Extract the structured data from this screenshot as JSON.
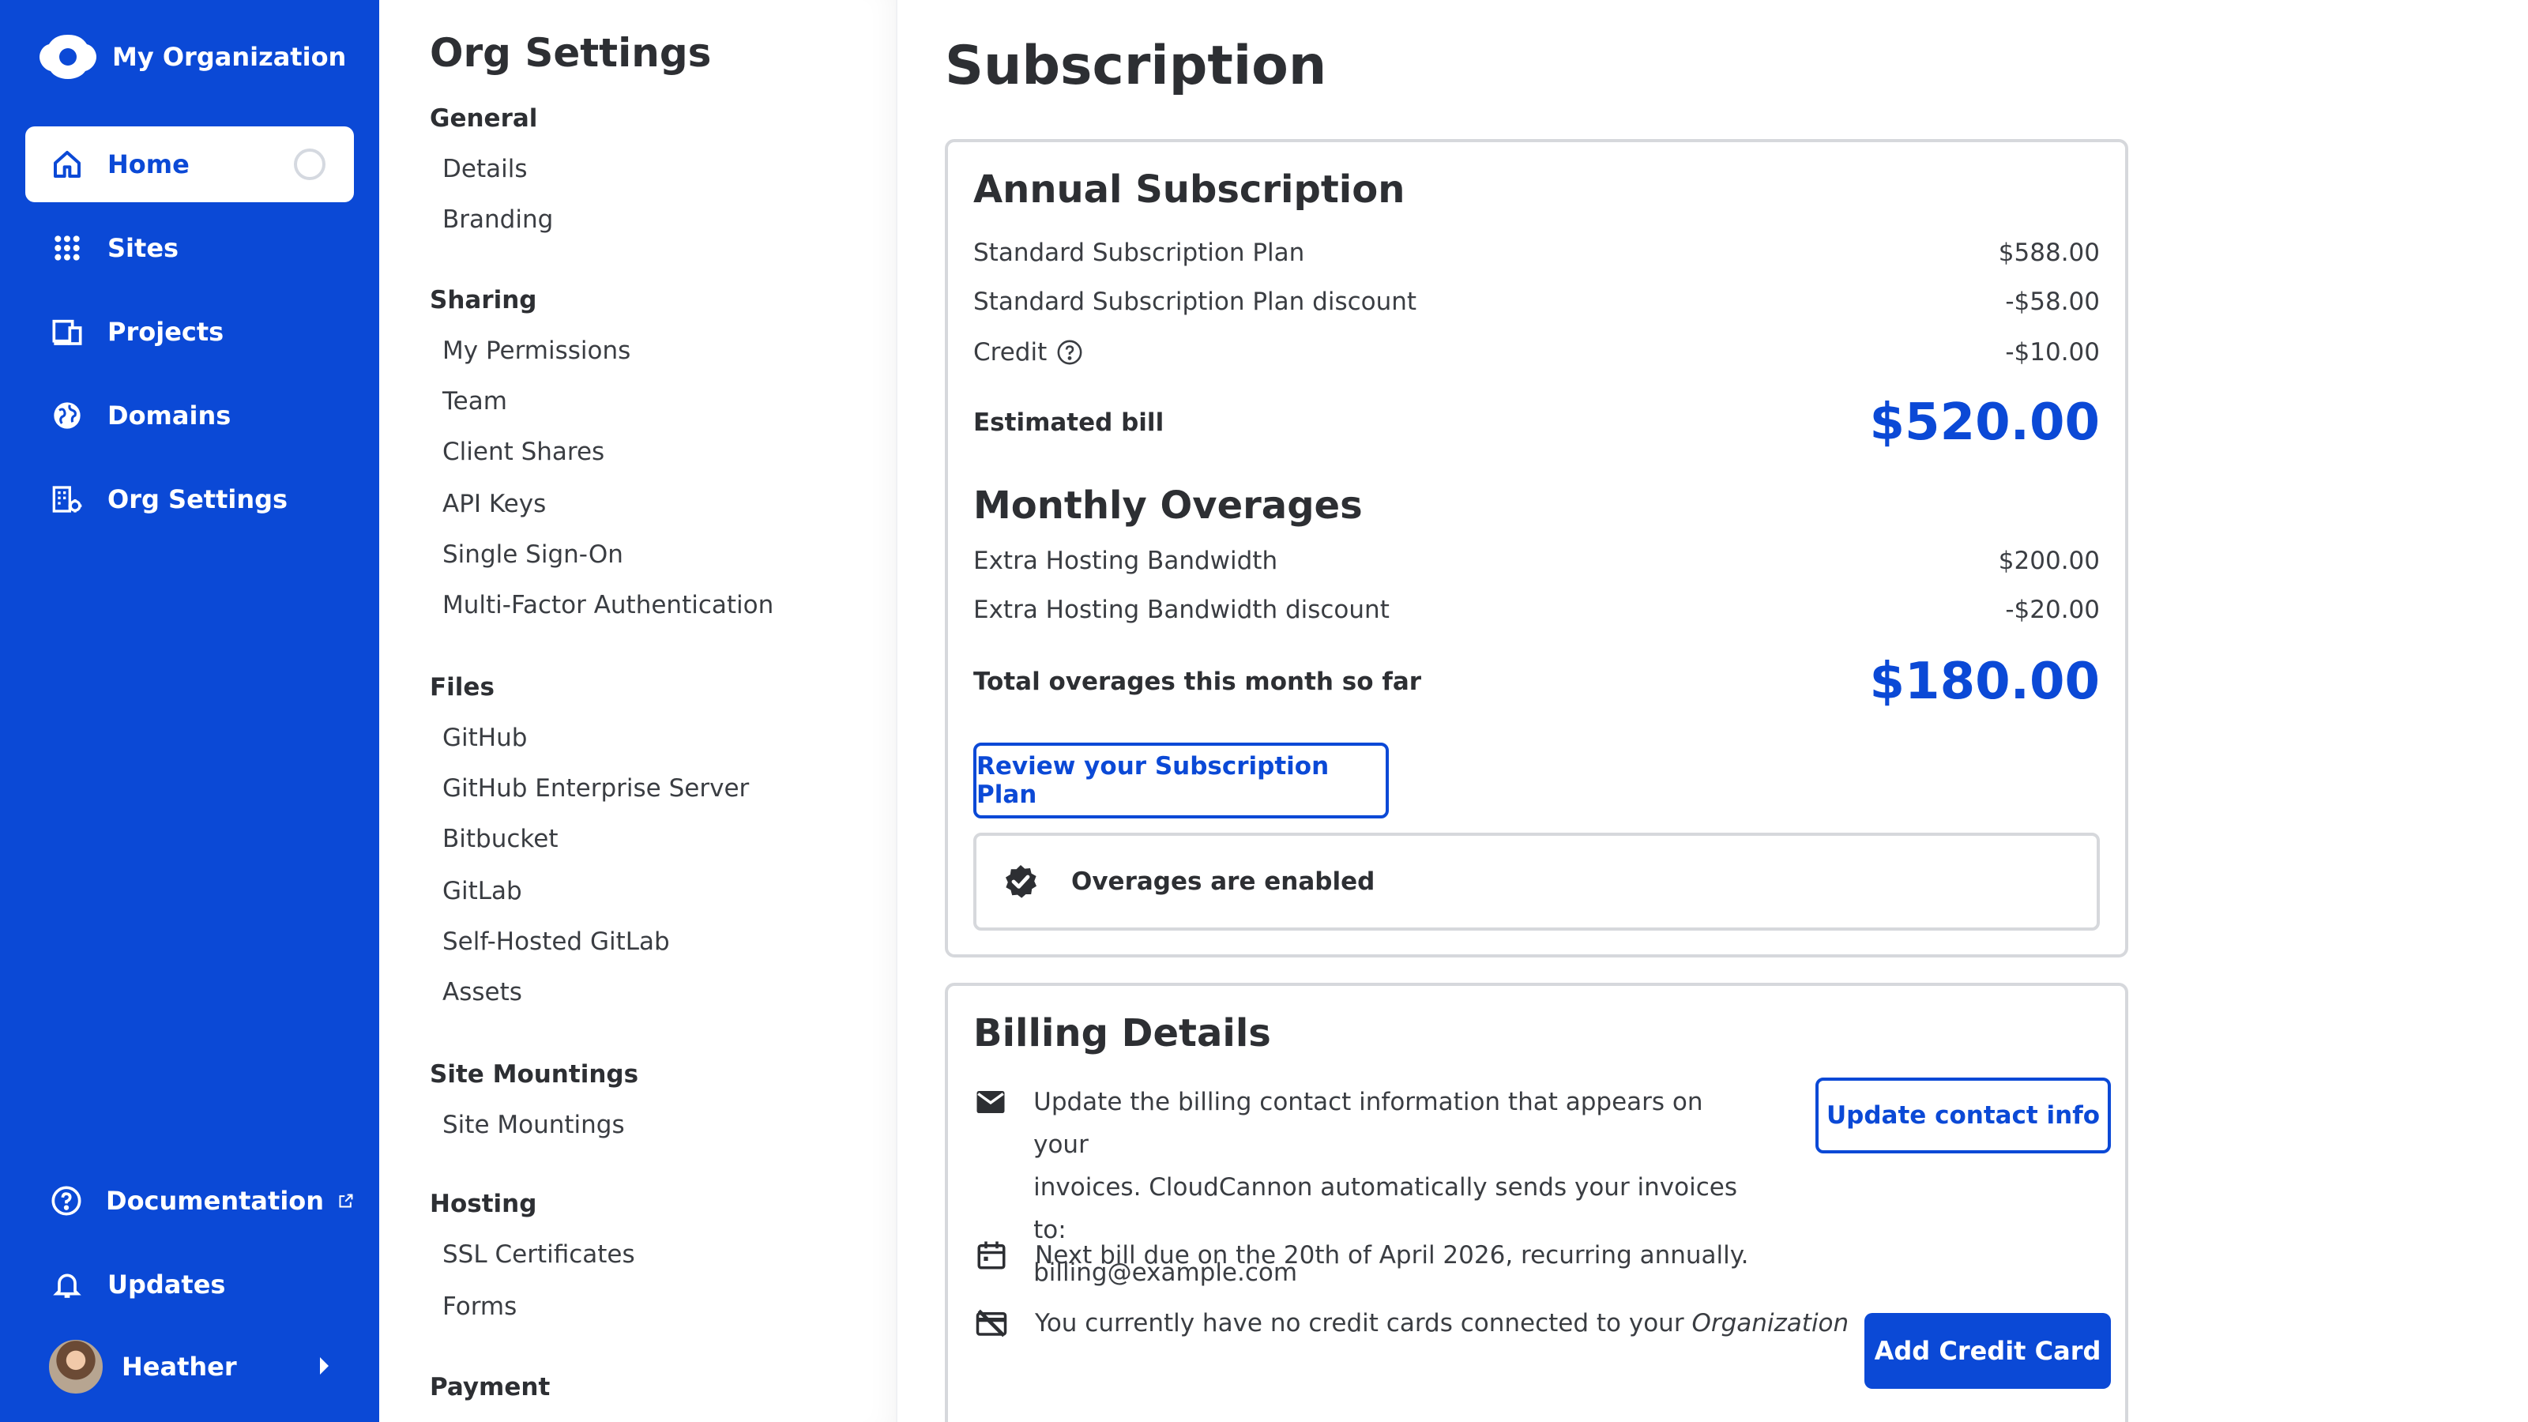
{
  "nav": {
    "org_name": "My Organization",
    "items": [
      {
        "label": "Home",
        "icon": "home-icon"
      },
      {
        "label": "Sites",
        "icon": "grid-icon"
      },
      {
        "label": "Projects",
        "icon": "devices-icon"
      },
      {
        "label": "Domains",
        "icon": "globe-icon"
      },
      {
        "label": "Org Settings",
        "icon": "org-settings-icon"
      }
    ],
    "documentation": "Documentation",
    "updates": "Updates",
    "user_name": "Heather"
  },
  "settings": {
    "title": "Org Settings",
    "sections": [
      {
        "title": "General",
        "links": [
          "Details",
          "Branding"
        ]
      },
      {
        "title": "Sharing",
        "links": [
          "My Permissions",
          "Team",
          "Client Shares",
          "API Keys",
          "Single Sign-On",
          "Multi-Factor Authentication"
        ]
      },
      {
        "title": "Files",
        "links": [
          "GitHub",
          "GitHub Enterprise Server",
          "Bitbucket",
          "GitLab",
          "Self-Hosted GitLab",
          "Assets"
        ]
      },
      {
        "title": "Site Mountings",
        "links": [
          "Site Mountings"
        ]
      },
      {
        "title": "Hosting",
        "links": [
          "SSL Certificates",
          "Forms"
        ]
      },
      {
        "title": "Payment",
        "links": []
      }
    ]
  },
  "main": {
    "title": "Subscription",
    "annual": {
      "title": "Annual Subscription",
      "rows": [
        {
          "label": "Standard Subscription Plan",
          "value": "$588.00"
        },
        {
          "label": "Standard Subscription Plan discount",
          "value": "-$58.00"
        },
        {
          "label": "Credit",
          "value": "-$10.00"
        }
      ],
      "estimated_label": "Estimated bill",
      "estimated_value": "$520.00"
    },
    "overages": {
      "title": "Monthly Overages",
      "rows": [
        {
          "label": "Extra Hosting Bandwidth",
          "value": "$200.00"
        },
        {
          "label": "Extra Hosting Bandwidth discount",
          "value": "-$20.00"
        }
      ],
      "total_label": "Total overages this month so far",
      "total_value": "$180.00"
    },
    "review_button": "Review your Subscription Plan",
    "overages_notice": "Overages are enabled",
    "billing": {
      "title": "Billing Details",
      "contact_line1": "Update the billing contact information that appears on your",
      "contact_line2": "invoices. CloudCannon automatically sends your invoices to:",
      "contact_email": "billing@example.com",
      "update_button": "Update contact info",
      "next_bill": "Next bill due on the 20th of April 2026, recurring annually.",
      "no_cards_prefix": "You currently have no credit cards connected to your ",
      "no_cards_emph": "Organization",
      "add_card_button": "Add Credit Card"
    }
  }
}
